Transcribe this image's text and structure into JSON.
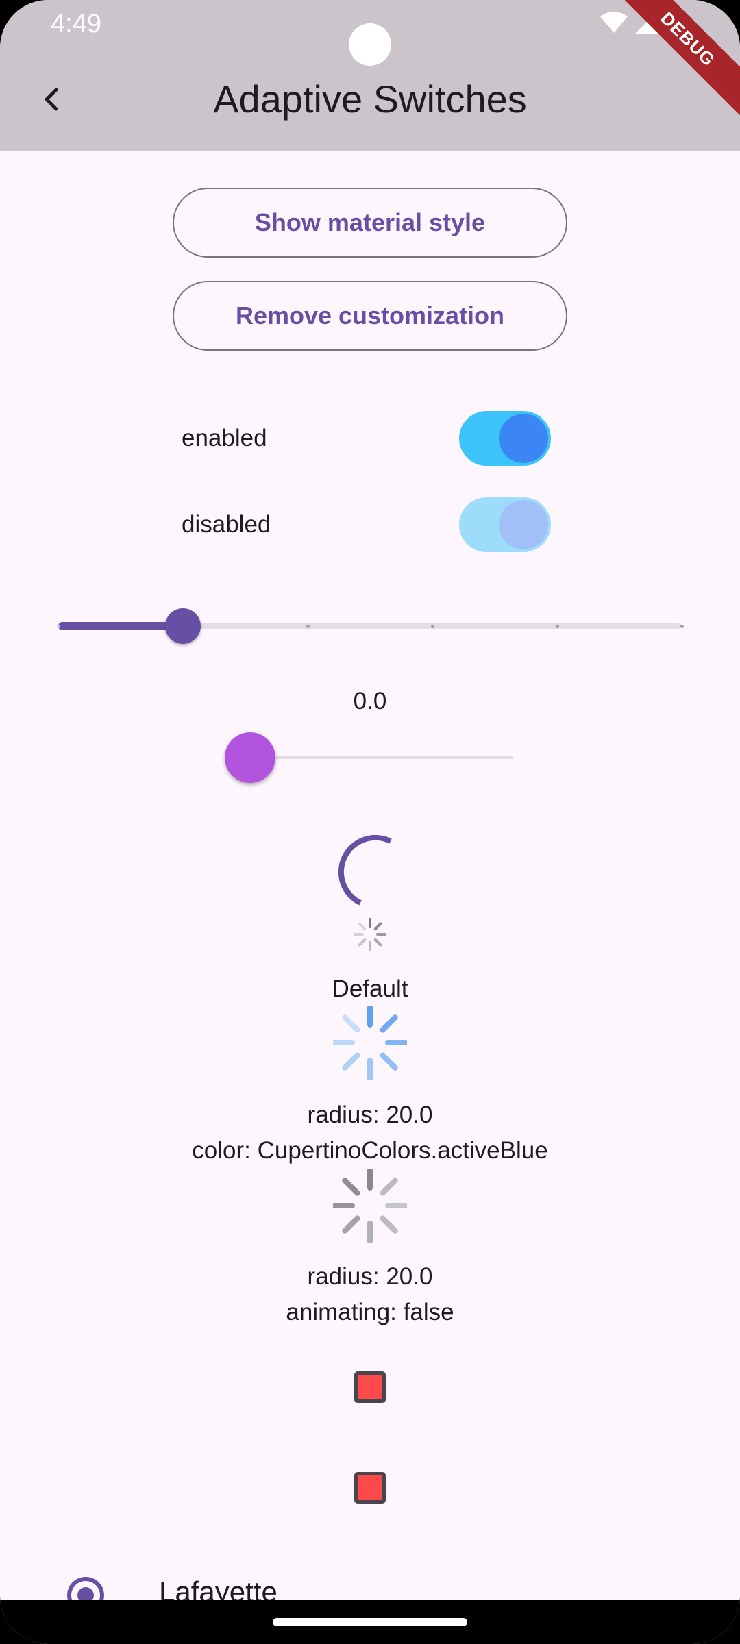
{
  "status_bar": {
    "time": "4:49"
  },
  "app_bar": {
    "title": "Adaptive Switches",
    "debug_banner": "DEBUG"
  },
  "buttons": {
    "show_material": "Show material style",
    "remove_customization": "Remove customization"
  },
  "switches": [
    {
      "label": "enabled",
      "on": true,
      "enabled": true
    },
    {
      "label": "disabled",
      "on": true,
      "enabled": false
    }
  ],
  "discrete_slider": {
    "value_fraction": 0.2,
    "divisions": 5
  },
  "continuous_slider": {
    "value_text": "0.0",
    "value_fraction": 0.0
  },
  "activity_indicators": {
    "default_label": "Default",
    "custom1_lines": [
      "radius: 20.0",
      "color: CupertinoColors.activeBlue"
    ],
    "custom2_lines": [
      "radius: 20.0",
      "animating: false"
    ]
  },
  "checkboxes": [
    {
      "checked": false,
      "color": "#fc4a4a"
    },
    {
      "checked": false,
      "color": "#fc4a4a"
    }
  ],
  "radio": {
    "label": "Lafayette",
    "selected": true
  },
  "colors": {
    "primary": "#6750a4",
    "switch_track": "#3cc4fa",
    "switch_thumb": "#3c86f4",
    "slider_thumb_purple": "#b354de",
    "active_blue": "#3c86f4"
  }
}
